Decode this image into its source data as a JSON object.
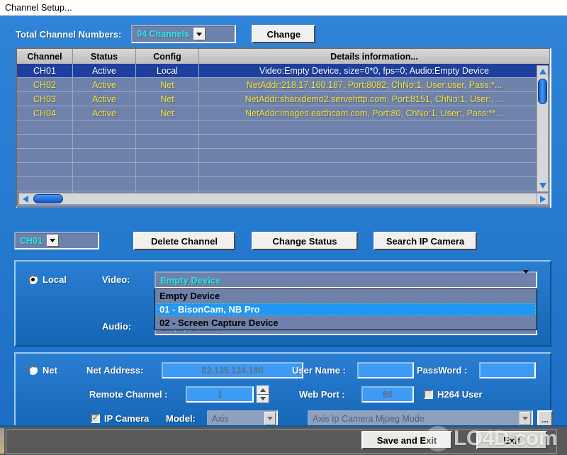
{
  "window": {
    "title": "Channel Setup..."
  },
  "header": {
    "total_label": "Total Channel Numbers:",
    "channels_value": "04 Channels",
    "change_label": "Change"
  },
  "table": {
    "columns": [
      "Channel",
      "Status",
      "Config",
      "Details information..."
    ],
    "rows": [
      {
        "channel": "CH01",
        "status": "Active",
        "config": "Local",
        "details": "Video:Empty Device, size=0*0, fps=0;  Audio:Empty Device",
        "selected": true
      },
      {
        "channel": "CH02",
        "status": "Active",
        "config": "Net",
        "details": "NetAddr:218.17.160.187, Port:8082, ChNo:1, User:user, Pass:*...",
        "selected": false
      },
      {
        "channel": "CH03",
        "status": "Active",
        "config": "Net",
        "details": "NetAddr:sharxdemo2.servehttp.com, Port:8151, ChNo:1, User:, ...",
        "selected": false
      },
      {
        "channel": "CH04",
        "status": "Active",
        "config": "Net",
        "details": "NetAddr:images.earthcam.com, Port:80, ChNo:1, User:, Pass:**...",
        "selected": false
      }
    ],
    "empty_row_count": 6
  },
  "actions": {
    "channel_select_value": "CH01",
    "delete_label": "Delete Channel",
    "change_status_label": "Change Status",
    "search_ip_label": "Search IP Camera"
  },
  "local_panel": {
    "radio_label": "Local",
    "radio_selected": true,
    "video_label": "Video:",
    "video_value": "Empty Device",
    "audio_label": "Audio:",
    "audio_value": "Empty Device",
    "dropdown_options": [
      {
        "label": "Empty Device",
        "highlighted": false
      },
      {
        "label": "01 - BisonCam, NB Pro",
        "highlighted": true
      },
      {
        "label": "02 - Screen Capture Device",
        "highlighted": false
      }
    ]
  },
  "net_panel": {
    "radio_label": "Net",
    "radio_selected": false,
    "net_address_label": "Net Address:",
    "net_address_value": "82.135.124.180",
    "user_name_label": "User Name :",
    "user_name_value": "",
    "password_label": "PassWord :",
    "password_value": "",
    "remote_channel_label": "Remote Channel :",
    "remote_channel_value": "1",
    "web_port_label": "Web Port :",
    "web_port_value": "80",
    "h264_label": "H264 User",
    "h264_checked": false,
    "ip_camera_label": "IP Camera",
    "ip_camera_checked": true,
    "model_label": "Model:",
    "model_value": "Axis",
    "mode_value": "Axis Ip Camera Mjpeg Mode",
    "ellipsis_label": "..."
  },
  "footer": {
    "save_exit_label": "Save and Exit",
    "exit_label": "Exit"
  },
  "watermark": {
    "text": "LO4D.com"
  },
  "colors": {
    "dialog_blue": "#2a7fd4",
    "row_slate": "#6f82ab",
    "selected_row": "#1e3f9e",
    "row_text_yellow": "#f3e03a",
    "combo_cyan": "#27e7e7",
    "highlight_blue": "#2196f3",
    "field_blue": "#3d9bf5"
  }
}
